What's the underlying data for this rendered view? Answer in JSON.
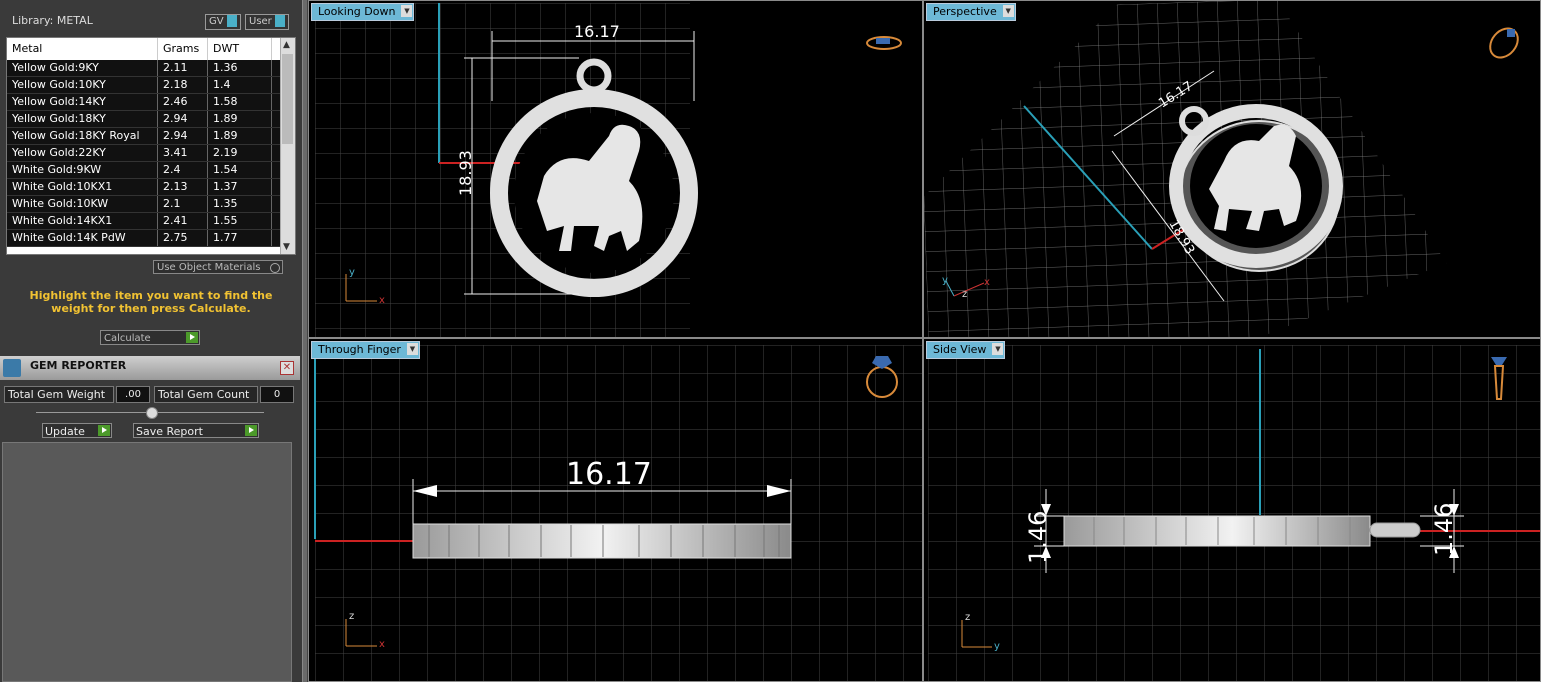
{
  "library": {
    "title": "Library: METAL",
    "toggle_gv": "GV",
    "toggle_user": "User",
    "columns": [
      "Metal",
      "Grams",
      "DWT"
    ],
    "rows": [
      [
        "Yellow Gold:9KY",
        "2.11",
        "1.36"
      ],
      [
        "Yellow Gold:10KY",
        "2.18",
        "1.4"
      ],
      [
        "Yellow Gold:14KY",
        "2.46",
        "1.58"
      ],
      [
        "Yellow Gold:18KY",
        "2.94",
        "1.89"
      ],
      [
        "Yellow Gold:18KY Royal",
        "2.94",
        "1.89"
      ],
      [
        "Yellow Gold:22KY",
        "3.41",
        "2.19"
      ],
      [
        "White Gold:9KW",
        "2.4",
        "1.54"
      ],
      [
        "White Gold:10KX1",
        "2.13",
        "1.37"
      ],
      [
        "White Gold:10KW",
        "2.1",
        "1.35"
      ],
      [
        "White Gold:14KX1",
        "2.41",
        "1.55"
      ],
      [
        "White Gold:14K PdW",
        "2.75",
        "1.77"
      ]
    ],
    "use_object_materials": "Use Object Materials",
    "hint": "Highlight the item you want to find the weight for then press Calculate.",
    "calculate": "Calculate"
  },
  "gem_reporter": {
    "title": "GEM REPORTER",
    "total_weight_label": "Total Gem Weight",
    "total_weight_value": ".00",
    "total_count_label": "Total Gem Count",
    "total_count_value": "0",
    "update": "Update",
    "save_report": "Save Report"
  },
  "viewports": {
    "top_left": {
      "label": "Looking Down",
      "width_dim": "16.17",
      "height_dim": "18.93"
    },
    "top_right": {
      "label": "Perspective",
      "width_dim": "16.17",
      "height_dim": "18.93"
    },
    "bottom_left": {
      "label": "Through Finger",
      "width_dim": "16.17"
    },
    "bottom_right": {
      "label": "Side View",
      "thickness_left": "1.46",
      "thickness_right": "1.46"
    }
  },
  "axes": {
    "top_left": [
      "y",
      "x"
    ],
    "top_right": [
      "y",
      "z",
      "x"
    ],
    "bottom_left": [
      "z",
      "x"
    ],
    "bottom_right": [
      "z",
      "y"
    ]
  },
  "colors": {
    "accent": "#6db8d6",
    "hint": "#f1c232",
    "go": "#4c9a2a",
    "grid": "#4a4a4a"
  }
}
